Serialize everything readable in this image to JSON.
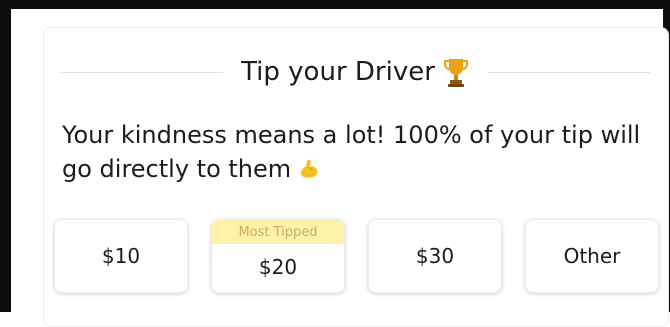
{
  "header": {
    "title": "Tip your Driver",
    "trophy_icon": "trophy-icon"
  },
  "message": {
    "text": "Your kindness means a lot! 100% of your tip will go directly to them",
    "emoji_icon": "flexed-biceps-icon"
  },
  "tips": [
    {
      "label": "$10"
    },
    {
      "label": "$20",
      "badge": "Most Tipped"
    },
    {
      "label": "$30"
    },
    {
      "label": "Other"
    }
  ],
  "colors": {
    "badge_bg": "#fff1a8",
    "badge_text": "#c9ae5a",
    "trophy": "#e8a317",
    "text": "#1c1c1c"
  }
}
